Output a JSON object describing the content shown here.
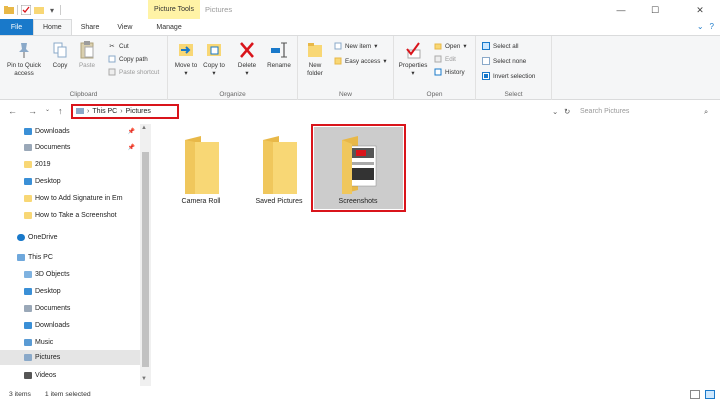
{
  "titlebar": {
    "context_tab": "Picture Tools",
    "title": "Pictures",
    "qat_icons": [
      "folder-icon",
      "check-icon",
      "folder-small-icon",
      "dropdown-icon"
    ],
    "controls": [
      "minimize-icon",
      "maximize-icon",
      "close-icon"
    ]
  },
  "tabs": {
    "file": "File",
    "home": "Home",
    "share": "Share",
    "view": "View",
    "manage": "Manage"
  },
  "ribbon": {
    "clipboard": {
      "label": "Clipboard",
      "pin": "Pin to Quick access",
      "copy": "Copy",
      "paste": "Paste",
      "cut": "Cut",
      "copy_path": "Copy path",
      "paste_shortcut": "Paste shortcut"
    },
    "organize": {
      "label": "Organize",
      "move_to": "Move to",
      "copy_to": "Copy to",
      "delete": "Delete",
      "rename": "Rename"
    },
    "new": {
      "label": "New",
      "new_folder": "New folder",
      "new_item": "New item",
      "easy_access": "Easy access"
    },
    "open": {
      "label": "Open",
      "properties": "Properties",
      "open": "Open",
      "edit": "Edit",
      "history": "History"
    },
    "select": {
      "label": "Select",
      "select_all": "Select all",
      "select_none": "Select none",
      "invert_selection": "Invert selection"
    }
  },
  "address": {
    "crumbs": [
      "This PC",
      "Pictures"
    ],
    "search_placeholder": "Search Pictures"
  },
  "navpane": {
    "quick_access": [
      "Downloads",
      "Documents",
      "2019",
      "Desktop",
      "How to Add Signature in Em",
      "How to Take a Screenshot"
    ],
    "onedrive": "OneDrive",
    "this_pc": "This PC",
    "pc_items": [
      "3D Objects",
      "Desktop",
      "Documents",
      "Downloads",
      "Music",
      "Pictures",
      "Videos"
    ]
  },
  "content": {
    "items": [
      "Camera Roll",
      "Saved Pictures",
      "Screenshots"
    ]
  },
  "status": {
    "count": "3 items",
    "selected": "1 item selected"
  },
  "colors": {
    "accent": "#1979ca",
    "highlight": "#d9141b",
    "folder": "#f8d775",
    "folder_dark": "#e8b848",
    "context": "#fff3a6"
  }
}
